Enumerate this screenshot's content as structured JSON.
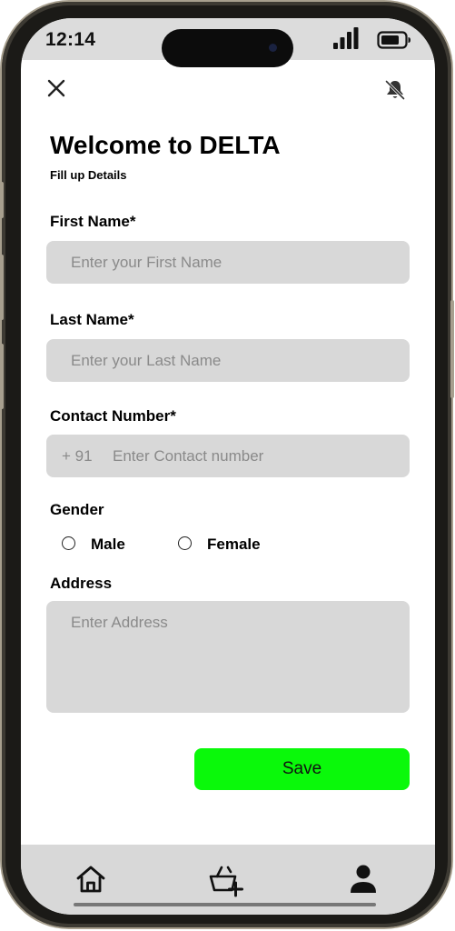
{
  "status_bar": {
    "time": "12:14",
    "signal_icon": "cellular-signal-icon",
    "battery_icon": "battery-icon"
  },
  "header": {
    "close_icon": "close-icon",
    "bell_icon": "bell-icon"
  },
  "form": {
    "title": "Welcome to DELTA",
    "subtitle": "Fill up Details",
    "first_name": {
      "label": "First Name*",
      "placeholder": "Enter your First Name",
      "value": ""
    },
    "last_name": {
      "label": "Last Name*",
      "placeholder": "Enter your Last Name",
      "value": ""
    },
    "contact": {
      "label": "Contact Number*",
      "prefix": "+ 91",
      "placeholder": "Enter Contact number",
      "value": ""
    },
    "gender": {
      "label": "Gender",
      "options": [
        {
          "label": "Male",
          "selected": false
        },
        {
          "label": "Female",
          "selected": false
        }
      ]
    },
    "address": {
      "label": "Address",
      "placeholder": "Enter Address",
      "value": ""
    },
    "save_label": "Save"
  },
  "bottom_nav": {
    "items": [
      {
        "icon": "home-icon"
      },
      {
        "icon": "cart-add-icon"
      },
      {
        "icon": "profile-icon"
      }
    ]
  },
  "colors": {
    "save_button": "#0af90a",
    "field_background": "#d8d8d8",
    "nav_background": "#d8d8d8",
    "status_bar_background": "#dcdcdc"
  }
}
